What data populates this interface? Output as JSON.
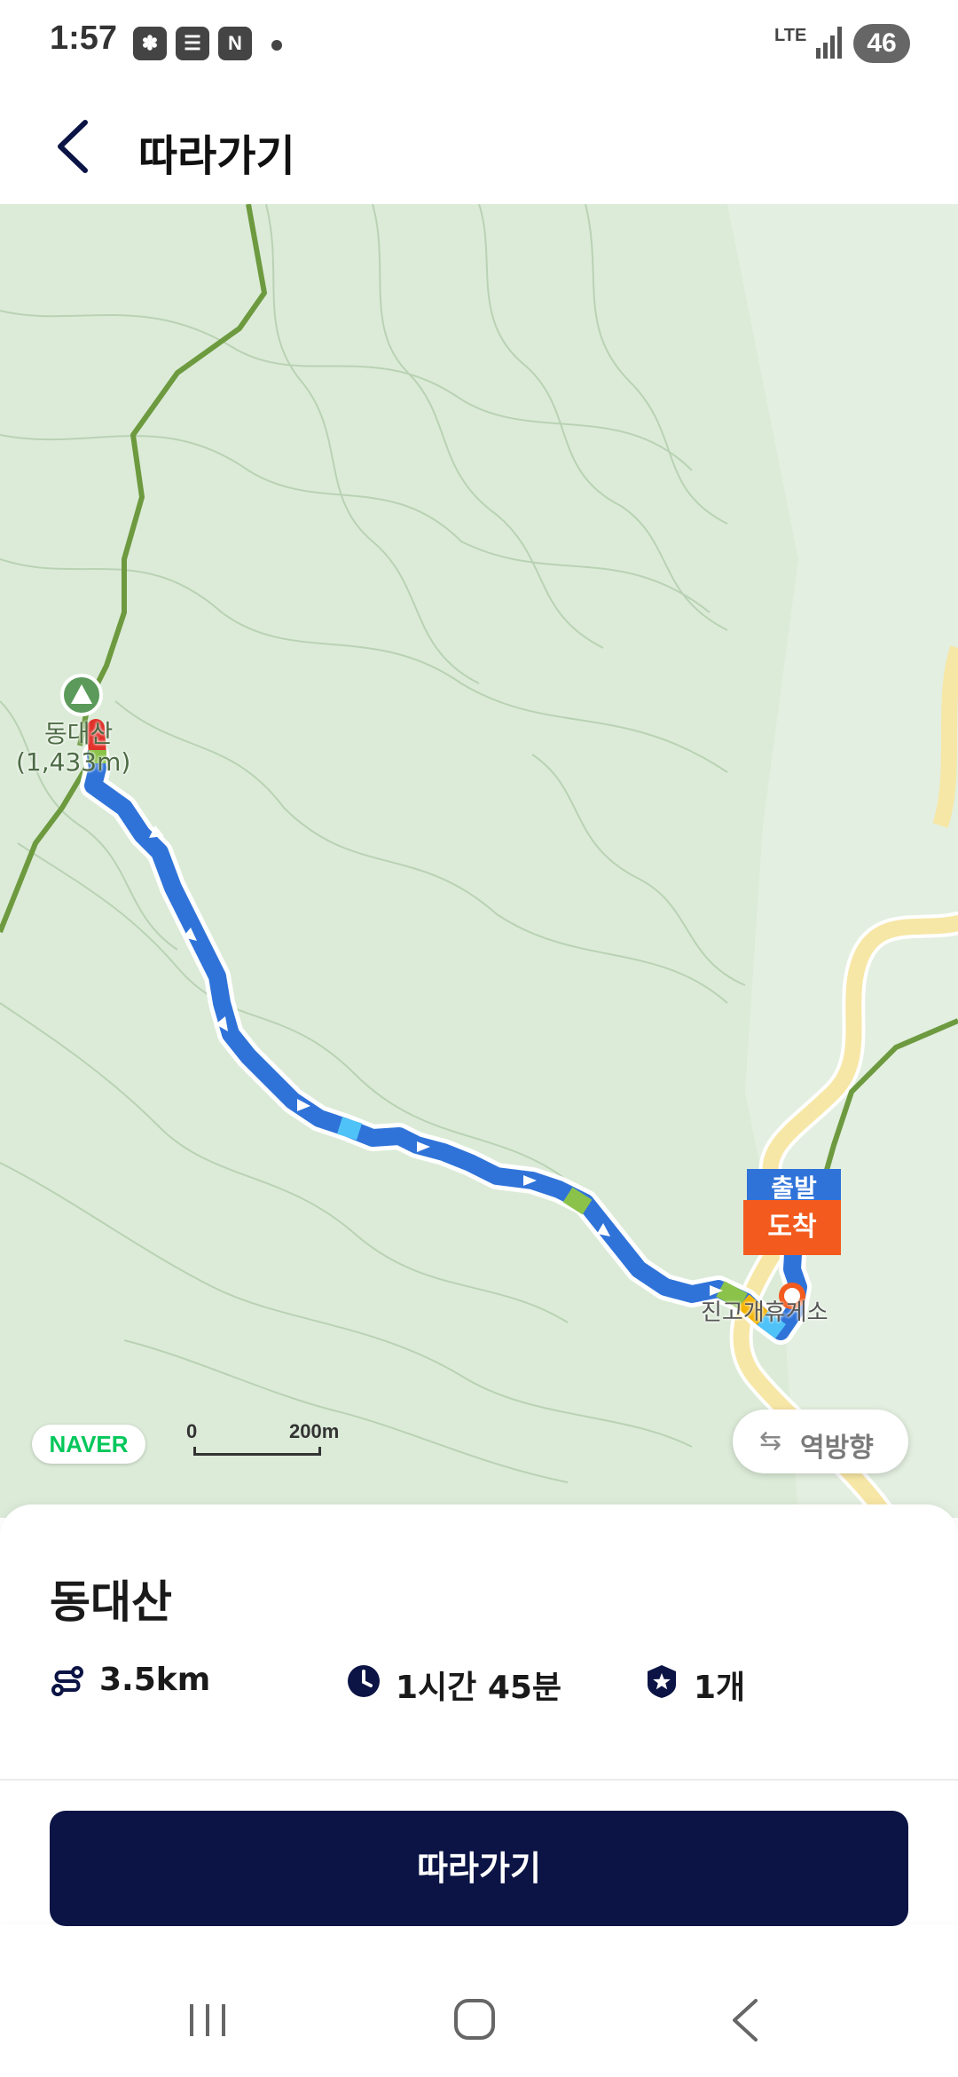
{
  "status_bar": {
    "time": "1:57",
    "notification_icons": [
      "app-icon",
      "flipboard-icon",
      "naver-icon"
    ],
    "naver_icon_letter": "N",
    "network": "LTE",
    "battery": "46"
  },
  "header": {
    "back_icon": "chevron-left-icon",
    "title": "따라가기"
  },
  "map": {
    "peak_name": "동대산",
    "peak_elevation": "(1,433m)",
    "poi_label": "진고개휴게소",
    "start_marker": "출발",
    "end_marker": "도착",
    "attribution": "NAVER",
    "scale_zero": "0",
    "scale_distance": "200m",
    "reverse_button_icon": "swap-arrows-icon",
    "reverse_button_label": "역방향",
    "route_color": "#2f73d9",
    "road_color": "#f7e7a6",
    "trail_color": "#6d9a3f"
  },
  "trail": {
    "name": "동대산",
    "distance": "3.5km",
    "distance_icon": "route-icon",
    "duration": "1시간 45분",
    "duration_icon": "clock-icon",
    "checkpoints": "1개",
    "checkpoints_icon": "star-shield-icon"
  },
  "primary_button": {
    "label": "따라가기",
    "color": "#0b1445"
  },
  "nav_bar": {
    "recents_icon": "recents-icon",
    "home_icon": "home-icon",
    "back_icon": "back-icon"
  }
}
